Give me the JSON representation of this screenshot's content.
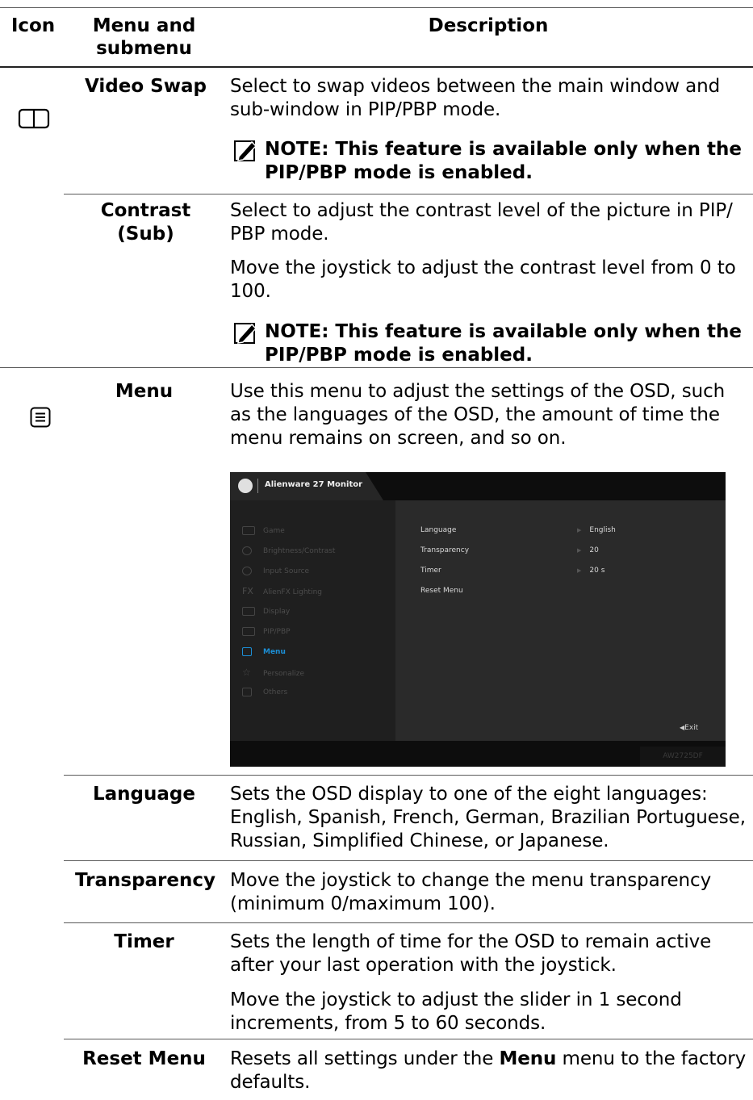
{
  "header": {
    "icon": "Icon",
    "menu": "Menu and submenu",
    "description": "Description"
  },
  "rows": {
    "video_swap": {
      "name": "Video Swap",
      "icon": "pip-pbp-icon",
      "desc": "Select to swap videos between the main window and sub-window in PIP/PBP mode.",
      "note": "NOTE: This feature is available only when the PIP/PBP mode is enabled."
    },
    "contrast_sub": {
      "name": "Contrast (Sub)",
      "desc1": "Select to adjust the contrast level of the picture in PIP/ PBP mode.",
      "desc2": "Move the joystick to adjust the contrast level from 0 to 100.",
      "note": "NOTE: This feature is available only when the PIP/PBP mode is enabled."
    },
    "menu": {
      "name": "Menu",
      "icon": "menu-icon",
      "desc": "Use this menu to adjust the settings of the OSD, such as the languages of the OSD, the amount of time the menu remains on screen, and so on."
    },
    "language": {
      "name": "Language",
      "desc": "Sets the OSD display to one of the eight languages: English, Spanish, French, German, Brazilian Portuguese, Russian, Simplified Chinese, or Japanese."
    },
    "transparency": {
      "name": "Transparency",
      "desc": "Move the joystick to change the menu transparency (minimum 0/maximum 100)."
    },
    "timer": {
      "name": "Timer",
      "desc1": "Sets the length of time for the OSD to remain active after your last operation with the joystick.",
      "desc2": "Move the joystick to adjust the slider in 1 second increments, from 5 to 60 seconds."
    },
    "reset_menu": {
      "name": "Reset Menu",
      "desc_pre": "Resets all settings under the ",
      "desc_bold": "Menu",
      "desc_post": " menu to the factory defaults."
    }
  },
  "osd": {
    "title": "Alienware 27 Monitor",
    "model": "AW2725DF",
    "exit": "Exit",
    "left_items": [
      "Game",
      "Brightness/Contrast",
      "Input Source",
      "AlienFX Lighting",
      "Display",
      "PIP/PBP",
      "Menu",
      "Personalize",
      "Others"
    ],
    "selected_index": 6,
    "right_items": [
      {
        "label": "Language",
        "value": "English"
      },
      {
        "label": "Transparency",
        "value": "20"
      },
      {
        "label": "Timer",
        "value": "20 s"
      },
      {
        "label": "Reset Menu",
        "value": ""
      }
    ],
    "accent_color": "#1c8fd6"
  }
}
